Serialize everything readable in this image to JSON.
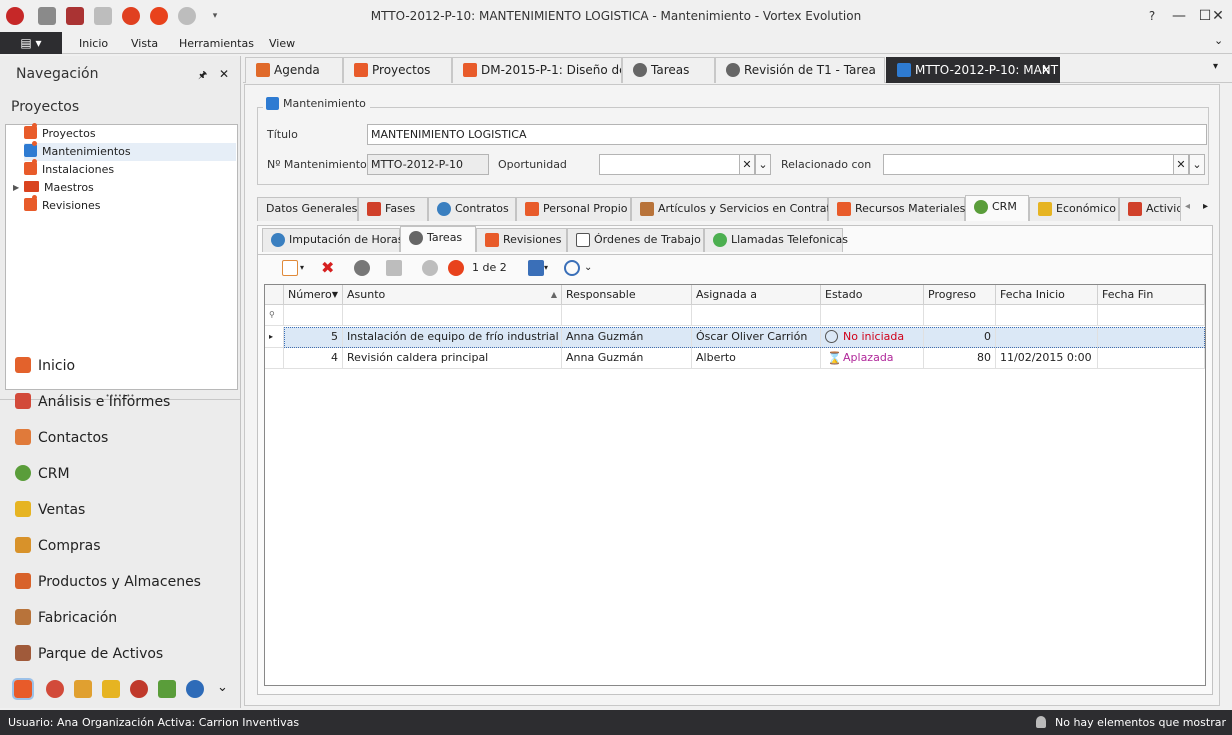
{
  "window": {
    "title": "MTTO-2012-P-10: MANTENIMIENTO LOGISTICA - Mantenimiento - Vortex Evolution",
    "minimize": "—",
    "maximize": "☐",
    "close": "✕",
    "help": "?"
  },
  "menu": {
    "app_button": "▤ ▾",
    "items": [
      "Inicio",
      "Vista",
      "Herramientas",
      "View"
    ]
  },
  "nav": {
    "header": "Navegación",
    "pin": "🖈",
    "close": "✕",
    "section": "Proyectos",
    "tree": [
      "Proyectos",
      "Mantenimientos",
      "Instalaciones",
      "Maestros",
      "Revisiones"
    ],
    "splitter": "•••••••",
    "groups": [
      "Inicio",
      "Análisis e Informes",
      "Contactos",
      "CRM",
      "Ventas",
      "Compras",
      "Productos y Almacenes",
      "Fabricación",
      "Parque de Activos"
    ],
    "more": "⌄"
  },
  "doc_tabs": [
    "Agenda",
    "Proyectos",
    "DM-2015-P-1: Diseño de",
    "Tareas",
    "Revisión de T1 - Tarea",
    "MTTO-2012-P-10: MANT"
  ],
  "doc_tab_close": "✕",
  "doc_tab_dropdown": "▾",
  "form": {
    "group_title": "Mantenimiento",
    "titulo_label": "Título",
    "titulo_value": "MANTENIMIENTO LOGISTICA",
    "numero_label": "Nº Mantenimiento",
    "numero_value": "MTTO-2012-P-10",
    "oportunidad_label": "Oportunidad",
    "oportunidad_value": "",
    "relacionado_label": "Relacionado con",
    "relacionado_value": "",
    "clear": "✕",
    "drop": "⌄"
  },
  "tabs": [
    "Datos Generales",
    "Fases",
    "Contratos",
    "Personal Propio",
    "Artículos y Servicios en Contrato",
    "Recursos Materiales",
    "CRM",
    "Económico",
    "Activid"
  ],
  "tab_scroll_left": "◂",
  "tab_scroll_right": "▸",
  "subtabs": [
    "Imputación de Horas",
    "Tareas",
    "Revisiones",
    "Órdenes de Trabajo",
    "Llamadas Telefonicas"
  ],
  "toolbar": {
    "pager": "1 de 2"
  },
  "grid": {
    "columns": [
      "Número",
      "Asunto",
      "Responsable",
      "Asignada a",
      "Estado",
      "Progreso",
      "Fecha Inicio",
      "Fecha Fin"
    ],
    "rows": [
      {
        "numero": "5",
        "asunto": "Instalación de equipo de frío industrial pri...",
        "responsable": "Anna Guzmán",
        "asignada": "Óscar Oliver Carrión",
        "estado": "No iniciada",
        "progreso": "0",
        "inicio": "",
        "fin": ""
      },
      {
        "numero": "4",
        "asunto": "Revisión caldera principal",
        "responsable": "Anna Guzmán",
        "asignada": "Alberto",
        "estado": "Aplazada",
        "progreso": "80",
        "inicio": "11/02/2015 0:00",
        "fin": ""
      }
    ]
  },
  "status": {
    "user": "Usuario: Ana",
    "org": "Organización Activa: Carrion Inventivas",
    "notifications": "No hay elementos que mostrar"
  },
  "colors": {
    "dark": "#2d2d30",
    "estado_red": "#d0021b",
    "estado_magenta": "#b0279a"
  }
}
